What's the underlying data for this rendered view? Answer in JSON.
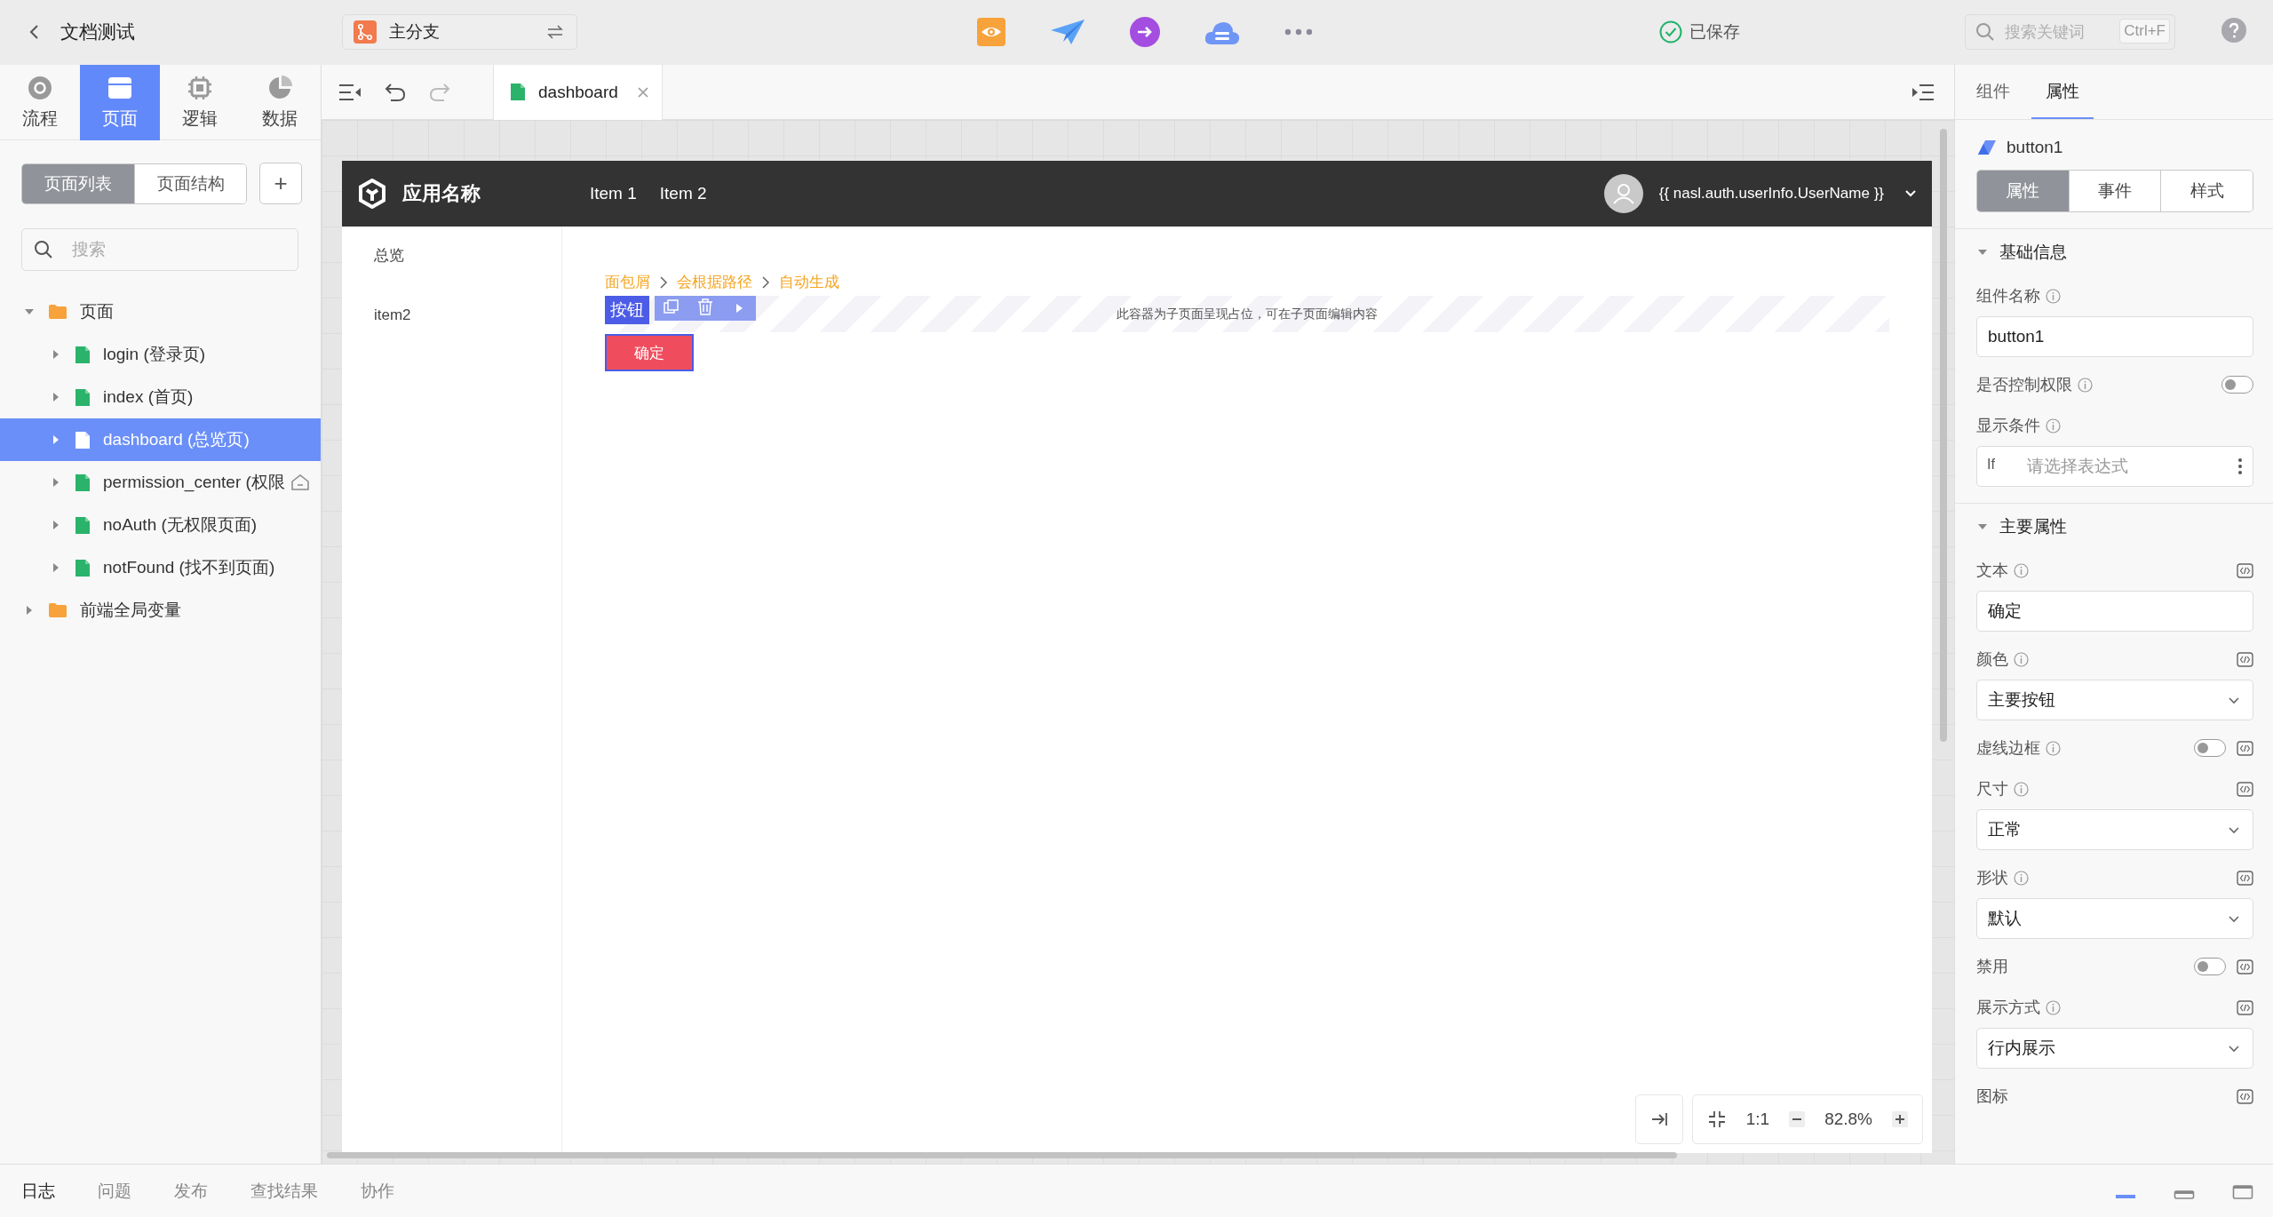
{
  "app": {
    "title": "文档测试",
    "branch": "主分支",
    "saved": "已保存",
    "search_placeholder": "搜索关键词",
    "search_shortcut": "Ctrl+F"
  },
  "rail_tabs": [
    {
      "label": "流程",
      "kind": "flow",
      "selected": false
    },
    {
      "label": "页面",
      "kind": "page",
      "selected": true
    },
    {
      "label": "逻辑",
      "kind": "logic",
      "selected": false
    },
    {
      "label": "数据",
      "kind": "data",
      "selected": false
    }
  ],
  "left_panel": {
    "view_tabs": [
      {
        "label": "页面列表",
        "selected": true
      },
      {
        "label": "页面结构",
        "selected": false
      }
    ],
    "add_button": "+",
    "search_placeholder": "搜索",
    "tree": [
      {
        "label": "页面",
        "kind": "folder",
        "expanded": true,
        "selected": false,
        "children": [
          {
            "label": "login (登录页)",
            "kind": "page",
            "expanded": false,
            "selected": false
          },
          {
            "label": "index (首页)",
            "kind": "page",
            "expanded": false,
            "selected": false
          },
          {
            "label": "dashboard (总览页)",
            "kind": "page",
            "expanded": false,
            "selected": true
          },
          {
            "label": "permission_center (权限",
            "kind": "page",
            "expanded": false,
            "selected": false,
            "home_mark": true
          },
          {
            "label": "noAuth (无权限页面)",
            "kind": "page",
            "expanded": false,
            "selected": false
          },
          {
            "label": "notFound (找不到页面)",
            "kind": "page",
            "expanded": false,
            "selected": false
          }
        ]
      },
      {
        "label": "前端全局变量",
        "kind": "folder",
        "expanded": false,
        "selected": false
      }
    ]
  },
  "editor_tabs": [
    {
      "label": "dashboard",
      "selected": true
    }
  ],
  "preview": {
    "app_name": "应用名称",
    "nav": [
      "Item 1",
      "Item 2"
    ],
    "user": "{{ nasl.auth.userInfo.UserName }}",
    "side_menu": [
      "总览",
      "item2"
    ],
    "breadcrumb": [
      "面包屑",
      "会根据路径",
      "自动生成"
    ],
    "component_tag": "按钮",
    "placeholder_text": "此容器为子页面呈现占位，可在子页面编辑内容",
    "button": "确定"
  },
  "zoom": {
    "ratio": "1:1",
    "value": "82.8%"
  },
  "right_panel": {
    "tabs": [
      {
        "label": "组件",
        "selected": false
      },
      {
        "label": "属性",
        "selected": true
      }
    ],
    "component": "button1",
    "sub_tabs": [
      {
        "label": "属性",
        "selected": true
      },
      {
        "label": "事件",
        "selected": false
      },
      {
        "label": "样式",
        "selected": false
      }
    ],
    "sections": [
      {
        "title": "基础信息",
        "expanded": true,
        "fields": [
          {
            "kind": "input",
            "label": "组件名称",
            "info": true,
            "code": false,
            "value": "button1"
          },
          {
            "kind": "switch",
            "label": "是否控制权限",
            "info": true,
            "code": false,
            "on": false
          },
          {
            "kind": "expression",
            "label": "显示条件",
            "info": true,
            "code": false,
            "prefix": "If",
            "placeholder": "请选择表达式"
          }
        ]
      },
      {
        "title": "主要属性",
        "expanded": true,
        "fields": [
          {
            "kind": "input",
            "label": "文本",
            "info": true,
            "code": true,
            "value": "确定"
          },
          {
            "kind": "select",
            "label": "颜色",
            "info": true,
            "code": true,
            "value": "主要按钮"
          },
          {
            "kind": "switch",
            "label": "虚线边框",
            "info": true,
            "code": true,
            "on": false
          },
          {
            "kind": "select",
            "label": "尺寸",
            "info": true,
            "code": true,
            "value": "正常"
          },
          {
            "kind": "select",
            "label": "形状",
            "info": true,
            "code": true,
            "value": "默认"
          },
          {
            "kind": "switch",
            "label": "禁用",
            "info": false,
            "code": true,
            "on": false
          },
          {
            "kind": "select",
            "label": "展示方式",
            "info": true,
            "code": true,
            "value": "行内展示"
          },
          {
            "kind": "heading",
            "label": "图标",
            "info": false,
            "code": true
          }
        ]
      }
    ]
  },
  "bottom_tabs": [
    {
      "label": "日志",
      "selected": true
    },
    {
      "label": "问题",
      "selected": false
    },
    {
      "label": "发布",
      "selected": false
    },
    {
      "label": "查找结果",
      "selected": false
    },
    {
      "label": "协作",
      "selected": false
    }
  ],
  "layout_buttons": [
    {
      "selected": true
    },
    {
      "selected": false
    },
    {
      "selected": false
    }
  ]
}
